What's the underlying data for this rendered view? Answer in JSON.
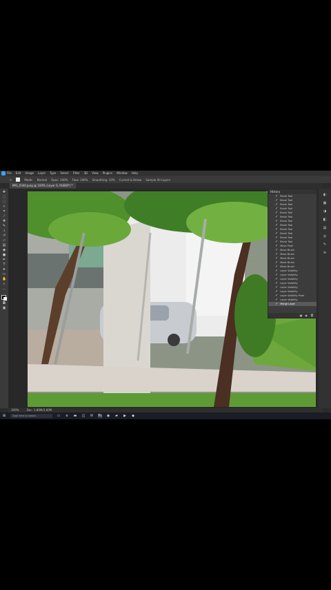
{
  "menubar": {
    "items": [
      "File",
      "Edit",
      "Image",
      "Layer",
      "Type",
      "Select",
      "Filter",
      "3D",
      "View",
      "Plugins",
      "Window",
      "Help"
    ]
  },
  "options": {
    "mode_label": "Mode:",
    "mode_value": "Normal",
    "opacity": "Opac: 100%",
    "flow": "Flow: 100%",
    "smoothing": "Smoothing: 10%",
    "align": "Current & Below",
    "sample_all": "Sample All Layers"
  },
  "document": {
    "tab_label": "IMG_0340.jpeg @ 100% (Layer 0, RGB/8*) *"
  },
  "history": {
    "title": "History",
    "items": [
      "Brush Tool",
      "Brush Tool",
      "Brush Tool",
      "Brush Tool",
      "Brush Tool",
      "Brush Tool",
      "Brush Tool",
      "Brush Tool",
      "Brush Tool",
      "Brush Tool",
      "Brush Tool",
      "Brush Tool",
      "Move Pixel",
      "Move Brush",
      "Move Brush",
      "Move Brush",
      "Move Brush",
      "Move Brush",
      "Layer Visibility",
      "Layer Visibility",
      "Layer Visibility",
      "Layer Visibility",
      "Layer Visibility",
      "Layer Visibility",
      "Layer Visibility Pixel",
      "Layer Visibility",
      "Merge Layer"
    ],
    "active_index": 26
  },
  "status": {
    "zoom": "100%",
    "doc_size": "Doc: 1.80M/3.60M"
  },
  "taskbar": {
    "search_placeholder": "Type here to search"
  },
  "icons": {
    "tools": [
      "move",
      "marquee",
      "lasso",
      "wand",
      "crop",
      "eyedropper",
      "healing",
      "brush",
      "stamp",
      "history-brush",
      "eraser",
      "gradient",
      "blur",
      "dodge",
      "pen",
      "type",
      "path-select",
      "shape",
      "hand",
      "zoom"
    ],
    "dock": [
      "color",
      "swatches",
      "adjustments",
      "libraries",
      "layers",
      "channels",
      "paths",
      "properties"
    ]
  },
  "colors": {
    "accent": "#31a8ff",
    "panel": "#3c3c3c",
    "background": "#2b2b2b"
  }
}
